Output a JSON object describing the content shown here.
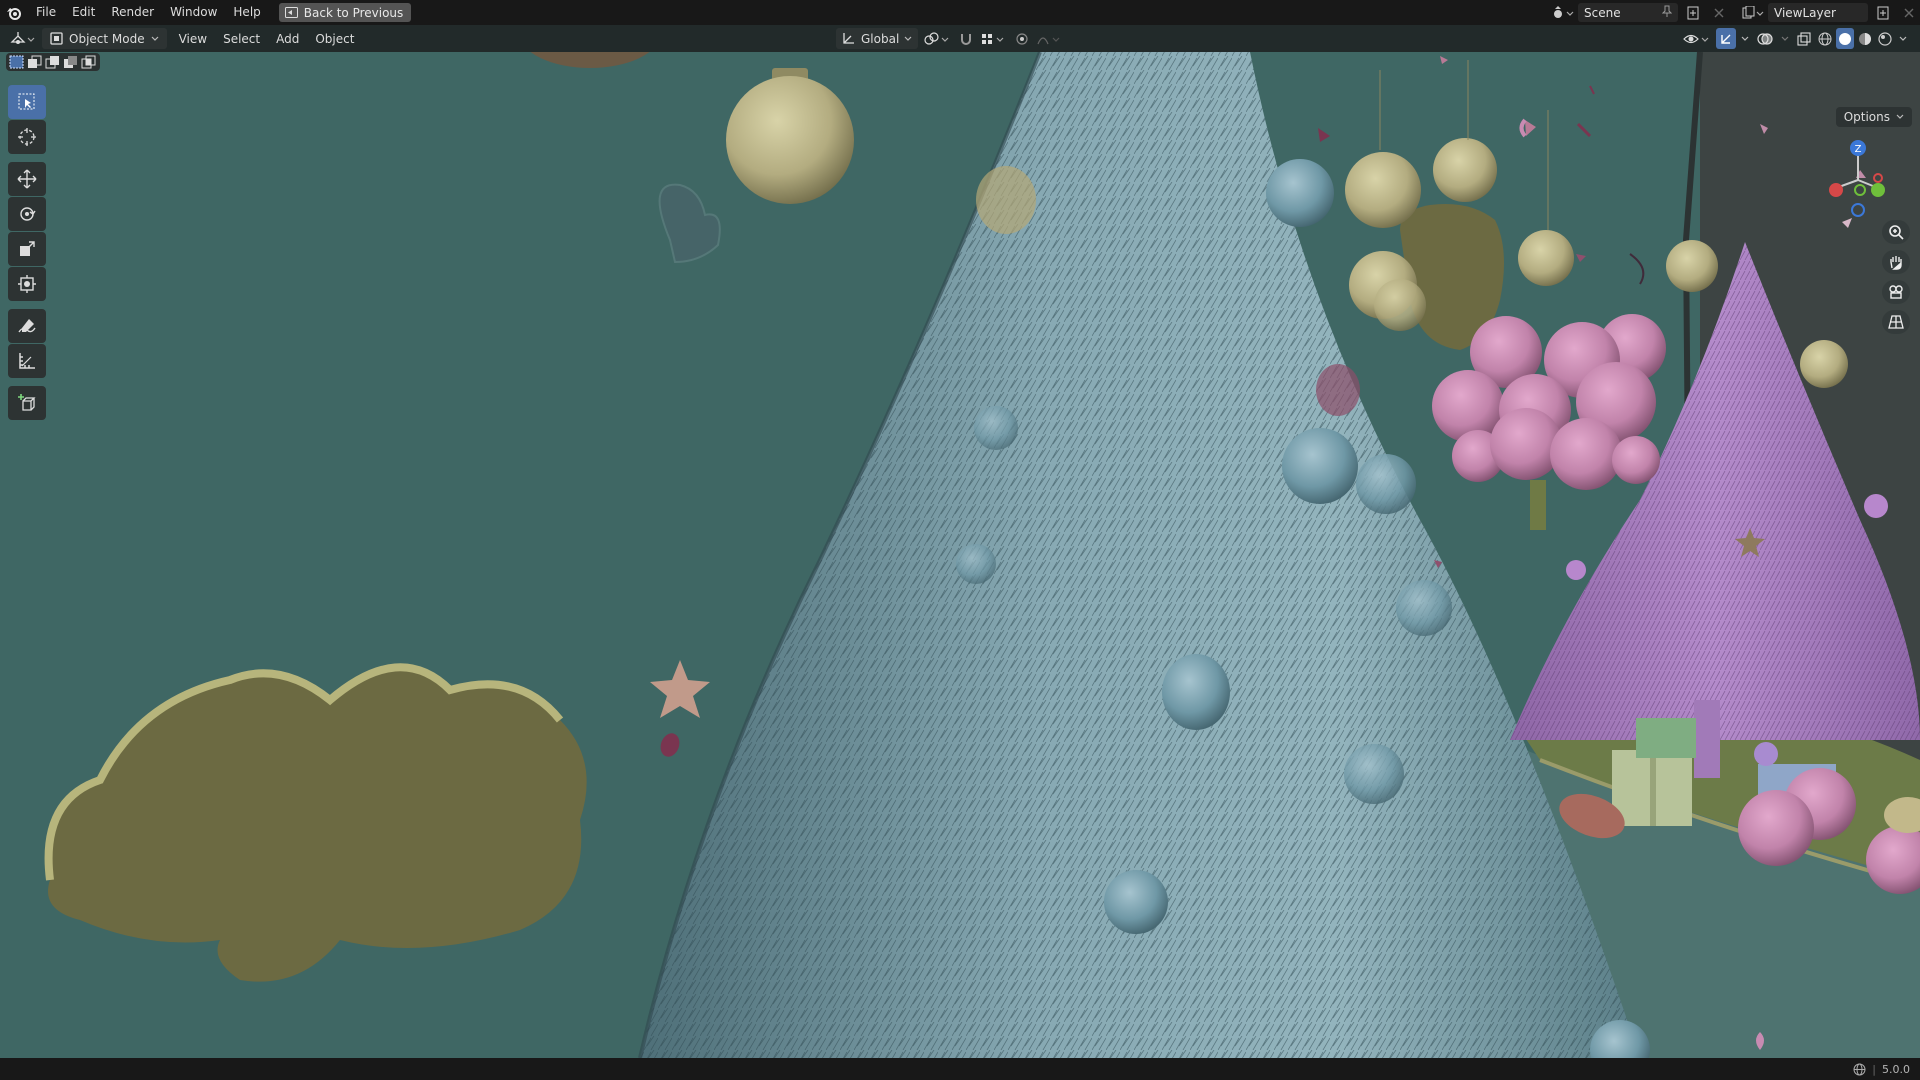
{
  "menubar": {
    "items": [
      "File",
      "Edit",
      "Render",
      "Window",
      "Help"
    ],
    "back_button": "Back to Previous",
    "scene_name": "Scene",
    "view_layer": "ViewLayer"
  },
  "header": {
    "mode": "Object Mode",
    "menus": [
      "View",
      "Select",
      "Add",
      "Object"
    ],
    "orientation": "Global"
  },
  "viewport": {
    "options_label": "Options",
    "gizmo_axis": "Z"
  },
  "statusbar": {
    "version": "5.0.0"
  },
  "colors": {
    "viewport_bg": "#3f6764",
    "tree_blue": "#7da2ad",
    "tree_purple": "#a97cc0",
    "ornament_gold": "#bab48a",
    "ornament_pink": "#c989b0",
    "cloud": "#6c6a42",
    "active_tool": "#4a70a8"
  }
}
